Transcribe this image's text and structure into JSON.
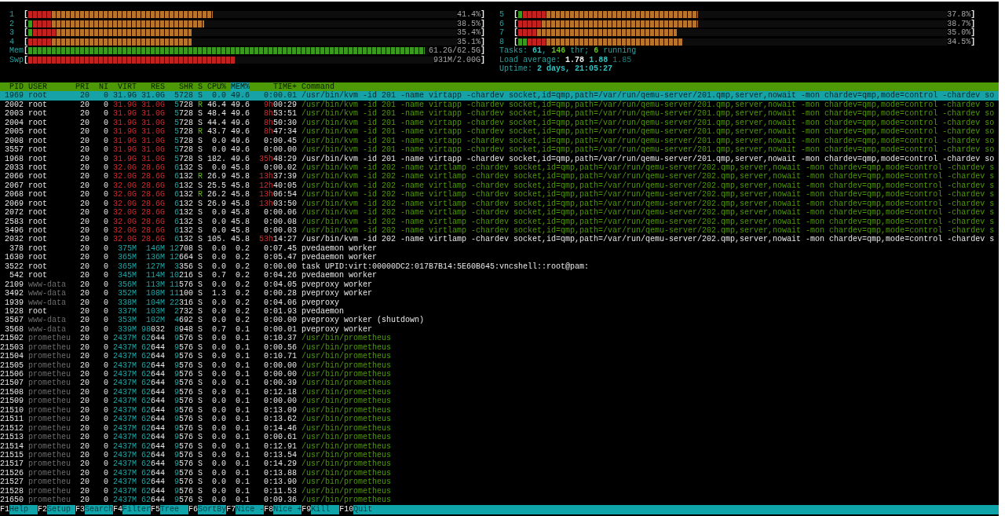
{
  "meters_left": [
    {
      "label": "1",
      "open": "[",
      "close": "]",
      "reading": "41.4%",
      "segments": [
        {
          "color": "#c42020",
          "level": 0.055
        },
        {
          "color": "#b8742a",
          "level": 0.43
        }
      ]
    },
    {
      "label": "2",
      "open": "[",
      "close": "]",
      "reading": "38.5%",
      "segments": [
        {
          "color": "#3a9a20",
          "level": 0.011
        },
        {
          "color": "#c42020",
          "level": 0.055
        },
        {
          "color": "#b8742a",
          "level": 0.41
        }
      ]
    },
    {
      "label": "3",
      "open": "[",
      "close": "]",
      "reading": "35.4%",
      "segments": [
        {
          "color": "#3a9a20",
          "level": 0.011
        },
        {
          "color": "#c42020",
          "level": 0.066
        },
        {
          "color": "#b8742a",
          "level": 0.38
        }
      ]
    },
    {
      "label": "4",
      "open": "[",
      "close": "]",
      "reading": "35.1%",
      "segments": [
        {
          "color": "#c42020",
          "level": 0.055
        },
        {
          "color": "#b8742a",
          "level": 0.38
        }
      ]
    },
    {
      "label": "Mem",
      "open": "[",
      "close": "]",
      "reading": "61.2G/62.5G",
      "segments": [
        {
          "color": "#3a9a20",
          "level": 0.99
        }
      ]
    },
    {
      "label": "Swp",
      "open": "[",
      "close": "]",
      "reading": "931M/2.00G",
      "segments": [
        {
          "color": "#c42020",
          "level": 0.51
        }
      ]
    }
  ],
  "meters_right": [
    {
      "label": "5",
      "open": "[",
      "close": "]",
      "reading": "37.8%",
      "segments": [
        {
          "color": "#3a9a20",
          "level": 0.011
        },
        {
          "color": "#c42020",
          "level": 0.066
        },
        {
          "color": "#b8742a",
          "level": 0.42
        }
      ]
    },
    {
      "label": "6",
      "open": "[",
      "close": "]",
      "reading": "38.7%",
      "segments": [
        {
          "color": "#c42020",
          "level": 0.055
        },
        {
          "color": "#b8742a",
          "level": 0.42
        }
      ]
    },
    {
      "label": "7",
      "open": "[",
      "close": "]",
      "reading": "35.0%",
      "segments": [
        {
          "color": "#c42020",
          "level": 0.044
        },
        {
          "color": "#b8742a",
          "level": 0.37
        }
      ]
    },
    {
      "label": "8",
      "open": "[",
      "close": "]",
      "reading": "34.5%",
      "segments": [
        {
          "color": "#3a9a20",
          "level": 0.022
        },
        {
          "color": "#c42020",
          "level": 0.066
        },
        {
          "color": "#b8742a",
          "level": 0.385
        }
      ]
    }
  ],
  "info": [
    {
      "parts": [
        {
          "text": "Tasks: ",
          "kind": "label"
        },
        {
          "text": "61",
          "kind": "value"
        },
        {
          "text": ", ",
          "kind": "label"
        },
        {
          "text": "146",
          "kind": "green"
        },
        {
          "text": " thr; ",
          "kind": "label"
        },
        {
          "text": "6",
          "kind": "green"
        },
        {
          "text": " running",
          "kind": "label"
        }
      ]
    },
    {
      "parts": [
        {
          "text": "Load average: ",
          "kind": "label"
        },
        {
          "text": "1.78 ",
          "kind": "white"
        },
        {
          "text": "1.88 ",
          "kind": "value"
        },
        {
          "text": "1.85",
          "kind": "dim"
        }
      ]
    },
    {
      "parts": [
        {
          "text": "Uptime: ",
          "kind": "label"
        },
        {
          "text": "2 days, 21:05:27",
          "kind": "value"
        }
      ]
    }
  ],
  "columns": [
    {
      "label": "PID",
      "selected": false
    },
    {
      "label": "USER",
      "selected": false
    },
    {
      "label": "PRI",
      "selected": false
    },
    {
      "label": "NI",
      "selected": false
    },
    {
      "label": "VIRT",
      "selected": false
    },
    {
      "label": "RES",
      "selected": false
    },
    {
      "label": "SHR",
      "selected": false
    },
    {
      "label": "S",
      "selected": false
    },
    {
      "label": "CPU%",
      "selected": false
    },
    {
      "label": "MEM%",
      "selected": true
    },
    {
      "label": "TIME+",
      "selected": false
    },
    {
      "label": "Command",
      "selected": false
    }
  ],
  "rows": [
    {
      "pid": "1969",
      "user": "root",
      "other_user": false,
      "pri": "20",
      "ni": "0",
      "virt": "31.9G",
      "res": "31.0G",
      "shr": "5728",
      "s": "S",
      "cpu": "0.0",
      "mem": "49.6",
      "time": "0:00.01",
      "command": "/usr/bin/kvm -id 201 -name virtapp -chardev socket,id=qmp,path=/var/run/qemu-server/201.qmp,server,nowait -mon chardev=qmp,mode=control -chardev so",
      "kind": "thread",
      "selected": true
    },
    {
      "pid": "2002",
      "user": "root",
      "other_user": false,
      "pri": "20",
      "ni": "0",
      "virt": "31.9G",
      "res": "31.0G",
      "shr": "5728",
      "s": "R",
      "cpu": "46.4",
      "mem": "49.6",
      "time": "9h00:29",
      "command": "/usr/bin/kvm -id 201 -name virtapp -chardev socket,id=qmp,path=/var/run/qemu-server/201.qmp,server,nowait -mon chardev=qmp,mode=control -chardev so",
      "kind": "thread",
      "selected": false
    },
    {
      "pid": "2003",
      "user": "root",
      "other_user": false,
      "pri": "20",
      "ni": "0",
      "virt": "31.9G",
      "res": "31.0G",
      "shr": "5728",
      "s": "S",
      "cpu": "48.4",
      "mem": "49.6",
      "time": "8h53:51",
      "command": "/usr/bin/kvm -id 201 -name virtapp -chardev socket,id=qmp,path=/var/run/qemu-server/201.qmp,server,nowait -mon chardev=qmp,mode=control -chardev so",
      "kind": "thread",
      "selected": false
    },
    {
      "pid": "2004",
      "user": "root",
      "other_user": false,
      "pri": "20",
      "ni": "0",
      "virt": "31.9G",
      "res": "31.0G",
      "shr": "5728",
      "s": "S",
      "cpu": "44.4",
      "mem": "49.6",
      "time": "8h50:30",
      "command": "/usr/bin/kvm -id 201 -name virtapp -chardev socket,id=qmp,path=/var/run/qemu-server/201.qmp,server,nowait -mon chardev=qmp,mode=control -chardev so",
      "kind": "thread",
      "selected": false
    },
    {
      "pid": "2005",
      "user": "root",
      "other_user": false,
      "pri": "20",
      "ni": "0",
      "virt": "31.9G",
      "res": "31.0G",
      "shr": "5728",
      "s": "R",
      "cpu": "43.7",
      "mem": "49.6",
      "time": "8h47:34",
      "command": "/usr/bin/kvm -id 201 -name virtapp -chardev socket,id=qmp,path=/var/run/qemu-server/201.qmp,server,nowait -mon chardev=qmp,mode=control -chardev so",
      "kind": "thread",
      "selected": false
    },
    {
      "pid": "2008",
      "user": "root",
      "other_user": false,
      "pri": "20",
      "ni": "0",
      "virt": "31.9G",
      "res": "31.0G",
      "shr": "5728",
      "s": "S",
      "cpu": "0.0",
      "mem": "49.6",
      "time": "0:00.45",
      "command": "/usr/bin/kvm -id 201 -name virtapp -chardev socket,id=qmp,path=/var/run/qemu-server/201.qmp,server,nowait -mon chardev=qmp,mode=control -chardev so",
      "kind": "thread",
      "selected": false
    },
    {
      "pid": "3557",
      "user": "root",
      "other_user": false,
      "pri": "20",
      "ni": "0",
      "virt": "31.9G",
      "res": "31.0G",
      "shr": "5728",
      "s": "S",
      "cpu": "0.0",
      "mem": "49.6",
      "time": "0:00.00",
      "command": "/usr/bin/kvm -id 201 -name virtapp -chardev socket,id=qmp,path=/var/run/qemu-server/201.qmp,server,nowait -mon chardev=qmp,mode=control -chardev so",
      "kind": "thread",
      "selected": false
    },
    {
      "pid": "1968",
      "user": "root",
      "other_user": false,
      "pri": "20",
      "ni": "0",
      "virt": "31.9G",
      "res": "31.0G",
      "shr": "5728",
      "s": "S",
      "cpu": "182.",
      "mem": "49.6",
      "time": "35h48:29",
      "command": "/usr/bin/kvm -id 201 -name virtapp -chardev socket,id=qmp,path=/var/run/qemu-server/201.qmp,server,nowait -mon chardev=qmp,mode=control -chardev so",
      "kind": "process",
      "selected": false
    },
    {
      "pid": "2033",
      "user": "root",
      "other_user": false,
      "pri": "20",
      "ni": "0",
      "virt": "32.0G",
      "res": "28.6G",
      "shr": "6132",
      "s": "S",
      "cpu": "0.0",
      "mem": "45.8",
      "time": "0:00.02",
      "command": "/usr/bin/kvm -id 202 -name virtlamp -chardev socket,id=qmp,path=/var/run/qemu-server/202.qmp,server,nowait -mon chardev=qmp,mode=control -chardev s",
      "kind": "thread",
      "selected": false
    },
    {
      "pid": "2066",
      "user": "root",
      "other_user": false,
      "pri": "20",
      "ni": "0",
      "virt": "32.0G",
      "res": "28.6G",
      "shr": "6132",
      "s": "R",
      "cpu": "26.9",
      "mem": "45.8",
      "time": "13h37:39",
      "command": "/usr/bin/kvm -id 202 -name virtlamp -chardev socket,id=qmp,path=/var/run/qemu-server/202.qmp,server,nowait -mon chardev=qmp,mode=control -chardev s",
      "kind": "thread",
      "selected": false
    },
    {
      "pid": "2067",
      "user": "root",
      "other_user": false,
      "pri": "20",
      "ni": "0",
      "virt": "32.0G",
      "res": "28.6G",
      "shr": "6132",
      "s": "S",
      "cpu": "25.5",
      "mem": "45.8",
      "time": "12h40:05",
      "command": "/usr/bin/kvm -id 202 -name virtlamp -chardev socket,id=qmp,path=/var/run/qemu-server/202.qmp,server,nowait -mon chardev=qmp,mode=control -chardev s",
      "kind": "thread",
      "selected": false
    },
    {
      "pid": "2068",
      "user": "root",
      "other_user": false,
      "pri": "20",
      "ni": "0",
      "virt": "32.0G",
      "res": "28.6G",
      "shr": "6132",
      "s": "R",
      "cpu": "26.2",
      "mem": "45.8",
      "time": "13h06:54",
      "command": "/usr/bin/kvm -id 202 -name virtlamp -chardev socket,id=qmp,path=/var/run/qemu-server/202.qmp,server,nowait -mon chardev=qmp,mode=control -chardev s",
      "kind": "thread",
      "selected": false
    },
    {
      "pid": "2069",
      "user": "root",
      "other_user": false,
      "pri": "20",
      "ni": "0",
      "virt": "32.0G",
      "res": "28.6G",
      "shr": "6132",
      "s": "S",
      "cpu": "26.9",
      "mem": "45.8",
      "time": "13h03:50",
      "command": "/usr/bin/kvm -id 202 -name virtlamp -chardev socket,id=qmp,path=/var/run/qemu-server/202.qmp,server,nowait -mon chardev=qmp,mode=control -chardev s",
      "kind": "thread",
      "selected": false
    },
    {
      "pid": "2072",
      "user": "root",
      "other_user": false,
      "pri": "20",
      "ni": "0",
      "virt": "32.0G",
      "res": "28.6G",
      "shr": "6132",
      "s": "S",
      "cpu": "0.0",
      "mem": "45.8",
      "time": "0:00.06",
      "command": "/usr/bin/kvm -id 202 -name virtlamp -chardev socket,id=qmp,path=/var/run/qemu-server/202.qmp,server,nowait -mon chardev=qmp,mode=control -chardev s",
      "kind": "thread",
      "selected": false
    },
    {
      "pid": "2583",
      "user": "root",
      "other_user": false,
      "pri": "20",
      "ni": "0",
      "virt": "32.0G",
      "res": "28.6G",
      "shr": "6132",
      "s": "S",
      "cpu": "0.0",
      "mem": "45.8",
      "time": "0:00.08",
      "command": "/usr/bin/kvm -id 202 -name virtlamp -chardev socket,id=qmp,path=/var/run/qemu-server/202.qmp,server,nowait -mon chardev=qmp,mode=control -chardev s",
      "kind": "thread",
      "selected": false
    },
    {
      "pid": "3496",
      "user": "root",
      "other_user": false,
      "pri": "20",
      "ni": "0",
      "virt": "32.0G",
      "res": "28.6G",
      "shr": "6132",
      "s": "S",
      "cpu": "0.0",
      "mem": "45.8",
      "time": "0:00.03",
      "command": "/usr/bin/kvm -id 202 -name virtlamp -chardev socket,id=qmp,path=/var/run/qemu-server/202.qmp,server,nowait -mon chardev=qmp,mode=control -chardev s",
      "kind": "thread",
      "selected": false
    },
    {
      "pid": "2032",
      "user": "root",
      "other_user": false,
      "pri": "20",
      "ni": "0",
      "virt": "32.0G",
      "res": "28.6G",
      "shr": "6132",
      "s": "S",
      "cpu": "105.",
      "mem": "45.8",
      "time": "53h14:27",
      "command": "/usr/bin/kvm -id 202 -name virtlamp -chardev socket,id=qmp,path=/var/run/qemu-server/202.qmp,server,nowait -mon chardev=qmp,mode=control -chardev s",
      "kind": "process",
      "selected": false
    },
    {
      "pid": "378",
      "user": "root",
      "other_user": false,
      "pri": "20",
      "ni": "0",
      "virt": "375M",
      "res": "146M",
      "shr": "12708",
      "s": "S",
      "cpu": "0.0",
      "mem": "0.2",
      "time": "0:07.45",
      "command": "pvedaemon worker",
      "kind": "process",
      "selected": false
    },
    {
      "pid": "1630",
      "user": "root",
      "other_user": false,
      "pri": "20",
      "ni": "0",
      "virt": "365M",
      "res": "136M",
      "shr": "12664",
      "s": "S",
      "cpu": "0.0",
      "mem": "0.2",
      "time": "0:05.47",
      "command": "pvedaemon worker",
      "kind": "process",
      "selected": false
    },
    {
      "pid": "3522",
      "user": "root",
      "other_user": false,
      "pri": "20",
      "ni": "0",
      "virt": "365M",
      "res": "127M",
      "shr": "3356",
      "s": "S",
      "cpu": "0.0",
      "mem": "0.2",
      "time": "0:00.00",
      "command": "task UPID:virt:00000DC2:017B7B14:5E60B645:vncshell::root@pam:",
      "kind": "process",
      "selected": false
    },
    {
      "pid": "542",
      "user": "root",
      "other_user": false,
      "pri": "20",
      "ni": "0",
      "virt": "345M",
      "res": "114M",
      "shr": "10216",
      "s": "S",
      "cpu": "0.7",
      "mem": "0.2",
      "time": "0:04.26",
      "command": "pvedaemon worker",
      "kind": "process",
      "selected": false
    },
    {
      "pid": "2109",
      "user": "www-data",
      "other_user": true,
      "pri": "20",
      "ni": "0",
      "virt": "356M",
      "res": "113M",
      "shr": "11576",
      "s": "S",
      "cpu": "0.0",
      "mem": "0.2",
      "time": "0:04.05",
      "command": "pveproxy worker",
      "kind": "process",
      "selected": false
    },
    {
      "pid": "3492",
      "user": "www-data",
      "other_user": true,
      "pri": "20",
      "ni": "0",
      "virt": "352M",
      "res": "108M",
      "shr": "11100",
      "s": "S",
      "cpu": "1.3",
      "mem": "0.2",
      "time": "0:00.28",
      "command": "pveproxy worker",
      "kind": "process",
      "selected": false
    },
    {
      "pid": "1939",
      "user": "www-data",
      "other_user": true,
      "pri": "20",
      "ni": "0",
      "virt": "338M",
      "res": "104M",
      "shr": "22316",
      "s": "S",
      "cpu": "0.0",
      "mem": "0.2",
      "time": "0:04.06",
      "command": "pveproxy",
      "kind": "process",
      "selected": false
    },
    {
      "pid": "1928",
      "user": "root",
      "other_user": false,
      "pri": "20",
      "ni": "0",
      "virt": "337M",
      "res": "103M",
      "shr": "2732",
      "s": "S",
      "cpu": "0.0",
      "mem": "0.2",
      "time": "0:01.93",
      "command": "pvedaemon",
      "kind": "process",
      "selected": false
    },
    {
      "pid": "3567",
      "user": "www-data",
      "other_user": true,
      "pri": "20",
      "ni": "0",
      "virt": "353M",
      "res": "102M",
      "shr": "4692",
      "s": "S",
      "cpu": "0.0",
      "mem": "0.2",
      "time": "0:00.00",
      "command": "pveproxy worker (shutdown)",
      "kind": "process",
      "selected": false
    },
    {
      "pid": "3568",
      "user": "www-data",
      "other_user": true,
      "pri": "20",
      "ni": "0",
      "virt": "339M",
      "res": "98032",
      "shr": "8948",
      "s": "S",
      "cpu": "0.7",
      "mem": "0.1",
      "time": "0:00.01",
      "command": "pveproxy worker",
      "kind": "process",
      "selected": false
    },
    {
      "pid": "21502",
      "user": "prometheu",
      "other_user": true,
      "pri": "20",
      "ni": "0",
      "virt": "2437M",
      "res": "62644",
      "shr": "9576",
      "s": "S",
      "cpu": "0.0",
      "mem": "0.1",
      "time": "0:10.37",
      "command": "/usr/bin/prometheus",
      "kind": "thread",
      "selected": false
    },
    {
      "pid": "21503",
      "user": "prometheu",
      "other_user": true,
      "pri": "20",
      "ni": "0",
      "virt": "2437M",
      "res": "62644",
      "shr": "9576",
      "s": "S",
      "cpu": "0.0",
      "mem": "0.1",
      "time": "0:00.56",
      "command": "/usr/bin/prometheus",
      "kind": "thread",
      "selected": false
    },
    {
      "pid": "21504",
      "user": "prometheu",
      "other_user": true,
      "pri": "20",
      "ni": "0",
      "virt": "2437M",
      "res": "62644",
      "shr": "9576",
      "s": "S",
      "cpu": "0.0",
      "mem": "0.1",
      "time": "0:10.71",
      "command": "/usr/bin/prometheus",
      "kind": "thread",
      "selected": false
    },
    {
      "pid": "21505",
      "user": "prometheu",
      "other_user": true,
      "pri": "20",
      "ni": "0",
      "virt": "2437M",
      "res": "62644",
      "shr": "9576",
      "s": "S",
      "cpu": "0.0",
      "mem": "0.1",
      "time": "0:00.00",
      "command": "/usr/bin/prometheus",
      "kind": "thread",
      "selected": false
    },
    {
      "pid": "21506",
      "user": "prometheu",
      "other_user": true,
      "pri": "20",
      "ni": "0",
      "virt": "2437M",
      "res": "62644",
      "shr": "9576",
      "s": "S",
      "cpu": "0.0",
      "mem": "0.1",
      "time": "0:00.00",
      "command": "/usr/bin/prometheus",
      "kind": "thread",
      "selected": false
    },
    {
      "pid": "21507",
      "user": "prometheu",
      "other_user": true,
      "pri": "20",
      "ni": "0",
      "virt": "2437M",
      "res": "62644",
      "shr": "9576",
      "s": "S",
      "cpu": "0.0",
      "mem": "0.1",
      "time": "0:00.39",
      "command": "/usr/bin/prometheus",
      "kind": "thread",
      "selected": false
    },
    {
      "pid": "21508",
      "user": "prometheu",
      "other_user": true,
      "pri": "20",
      "ni": "0",
      "virt": "2437M",
      "res": "62644",
      "shr": "9576",
      "s": "S",
      "cpu": "0.0",
      "mem": "0.1",
      "time": "0:12.18",
      "command": "/usr/bin/prometheus",
      "kind": "thread",
      "selected": false
    },
    {
      "pid": "21509",
      "user": "prometheu",
      "other_user": true,
      "pri": "20",
      "ni": "0",
      "virt": "2437M",
      "res": "62644",
      "shr": "9576",
      "s": "S",
      "cpu": "0.0",
      "mem": "0.1",
      "time": "0:00.00",
      "command": "/usr/bin/prometheus",
      "kind": "thread",
      "selected": false
    },
    {
      "pid": "21510",
      "user": "prometheu",
      "other_user": true,
      "pri": "20",
      "ni": "0",
      "virt": "2437M",
      "res": "62644",
      "shr": "9576",
      "s": "S",
      "cpu": "0.0",
      "mem": "0.1",
      "time": "0:13.09",
      "command": "/usr/bin/prometheus",
      "kind": "thread",
      "selected": false
    },
    {
      "pid": "21511",
      "user": "prometheu",
      "other_user": true,
      "pri": "20",
      "ni": "0",
      "virt": "2437M",
      "res": "62644",
      "shr": "9576",
      "s": "S",
      "cpu": "0.0",
      "mem": "0.1",
      "time": "0:13.62",
      "command": "/usr/bin/prometheus",
      "kind": "thread",
      "selected": false
    },
    {
      "pid": "21512",
      "user": "prometheu",
      "other_user": true,
      "pri": "20",
      "ni": "0",
      "virt": "2437M",
      "res": "62644",
      "shr": "9576",
      "s": "S",
      "cpu": "0.0",
      "mem": "0.1",
      "time": "0:14.46",
      "command": "/usr/bin/prometheus",
      "kind": "thread",
      "selected": false
    },
    {
      "pid": "21513",
      "user": "prometheu",
      "other_user": true,
      "pri": "20",
      "ni": "0",
      "virt": "2437M",
      "res": "62644",
      "shr": "9576",
      "s": "S",
      "cpu": "0.0",
      "mem": "0.1",
      "time": "0:00.61",
      "command": "/usr/bin/prometheus",
      "kind": "thread",
      "selected": false
    },
    {
      "pid": "21514",
      "user": "prometheu",
      "other_user": true,
      "pri": "20",
      "ni": "0",
      "virt": "2437M",
      "res": "62644",
      "shr": "9576",
      "s": "S",
      "cpu": "0.0",
      "mem": "0.1",
      "time": "0:12.91",
      "command": "/usr/bin/prometheus",
      "kind": "thread",
      "selected": false
    },
    {
      "pid": "21515",
      "user": "prometheu",
      "other_user": true,
      "pri": "20",
      "ni": "0",
      "virt": "2437M",
      "res": "62644",
      "shr": "9576",
      "s": "S",
      "cpu": "0.0",
      "mem": "0.1",
      "time": "0:13.54",
      "command": "/usr/bin/prometheus",
      "kind": "thread",
      "selected": false
    },
    {
      "pid": "21517",
      "user": "prometheu",
      "other_user": true,
      "pri": "20",
      "ni": "0",
      "virt": "2437M",
      "res": "62644",
      "shr": "9576",
      "s": "S",
      "cpu": "0.0",
      "mem": "0.1",
      "time": "0:14.29",
      "command": "/usr/bin/prometheus",
      "kind": "thread",
      "selected": false
    },
    {
      "pid": "21526",
      "user": "prometheu",
      "other_user": true,
      "pri": "20",
      "ni": "0",
      "virt": "2437M",
      "res": "62644",
      "shr": "9576",
      "s": "S",
      "cpu": "0.0",
      "mem": "0.1",
      "time": "0:13.88",
      "command": "/usr/bin/prometheus",
      "kind": "thread",
      "selected": false
    },
    {
      "pid": "21527",
      "user": "prometheu",
      "other_user": true,
      "pri": "20",
      "ni": "0",
      "virt": "2437M",
      "res": "62644",
      "shr": "9576",
      "s": "S",
      "cpu": "0.0",
      "mem": "0.1",
      "time": "0:13.90",
      "command": "/usr/bin/prometheus",
      "kind": "thread",
      "selected": false
    },
    {
      "pid": "21528",
      "user": "prometheu",
      "other_user": true,
      "pri": "20",
      "ni": "0",
      "virt": "2437M",
      "res": "62644",
      "shr": "9576",
      "s": "S",
      "cpu": "0.0",
      "mem": "0.1",
      "time": "0:11.53",
      "command": "/usr/bin/prometheus",
      "kind": "thread",
      "selected": false
    },
    {
      "pid": "21650",
      "user": "prometheu",
      "other_user": true,
      "pri": "20",
      "ni": "0",
      "virt": "2437M",
      "res": "62644",
      "shr": "9576",
      "s": "S",
      "cpu": "0.0",
      "mem": "0.1",
      "time": "0:09.36",
      "command": "/usr/bin/prometheus",
      "kind": "thread",
      "selected": false
    }
  ],
  "function_keys": [
    {
      "key": "F1",
      "label": "Help"
    },
    {
      "key": "F2",
      "label": "Setup"
    },
    {
      "key": "F3",
      "label": "Search"
    },
    {
      "key": "F4",
      "label": "Filter"
    },
    {
      "key": "F5",
      "label": "Tree"
    },
    {
      "key": "F6",
      "label": "SortBy"
    },
    {
      "key": "F7",
      "label": "Nice -"
    },
    {
      "key": "F8",
      "label": "Nice +"
    },
    {
      "key": "F9",
      "label": "Kill"
    },
    {
      "key": "F10",
      "label": "Quit"
    }
  ]
}
